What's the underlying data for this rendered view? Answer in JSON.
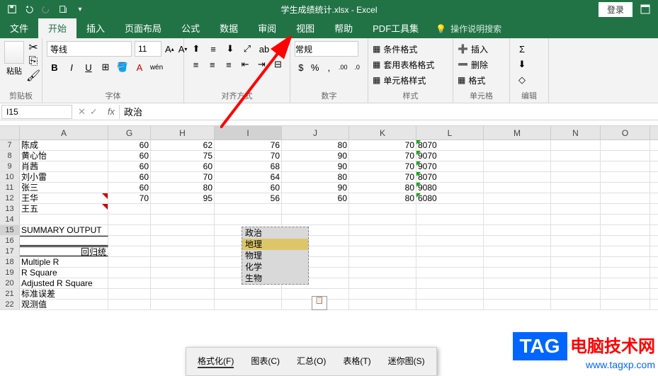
{
  "titlebar": {
    "filename": "学生成绩统计.xlsx",
    "app": "Excel",
    "login": "登录"
  },
  "tabs": {
    "file": "文件",
    "home": "开始",
    "insert": "插入",
    "layout": "页面布局",
    "formula": "公式",
    "data": "数据",
    "review": "审阅",
    "view": "视图",
    "help": "帮助",
    "pdf": "PDF工具集",
    "tellme": "操作说明搜索"
  },
  "ribbon": {
    "clipboard_label": "剪贴板",
    "paste": "粘贴",
    "font_label": "字体",
    "font_name": "等线",
    "font_size": "11",
    "align_label": "对齐方式",
    "number_label": "数字",
    "number_format": "常规",
    "styles_label": "样式",
    "cond_format": "条件格式",
    "table_format": "套用表格格式",
    "cell_style": "单元格样式",
    "cells_label": "单元格",
    "insert_btn": "插入",
    "delete_btn": "删除",
    "format_btn": "格式",
    "edit_label": "编辑"
  },
  "namebox": {
    "ref": "I15",
    "formula": "政治"
  },
  "columns": [
    "A",
    "G",
    "H",
    "I",
    "J",
    "K",
    "L",
    "M",
    "N",
    "O"
  ],
  "rows": [
    {
      "n": "7",
      "A": "陈成",
      "G": "60",
      "H": "62",
      "I": "76",
      "J": "80",
      "K": "70",
      "L": "8070"
    },
    {
      "n": "8",
      "A": "黄心怡",
      "G": "60",
      "H": "75",
      "I": "70",
      "J": "90",
      "K": "70",
      "L": "9070"
    },
    {
      "n": "9",
      "A": "肖茜",
      "G": "60",
      "H": "60",
      "I": "68",
      "J": "90",
      "K": "70",
      "L": "9070"
    },
    {
      "n": "10",
      "A": "刘小雷",
      "G": "60",
      "H": "70",
      "I": "64",
      "J": "80",
      "K": "70",
      "L": "8070"
    },
    {
      "n": "11",
      "A": "张三",
      "G": "60",
      "H": "80",
      "I": "60",
      "J": "90",
      "K": "80",
      "L": "9080"
    },
    {
      "n": "12",
      "A": "王华",
      "G": "70",
      "H": "95",
      "I": "56",
      "J": "60",
      "K": "80",
      "L": "6080"
    },
    {
      "n": "13",
      "A": "王五"
    },
    {
      "n": "14"
    },
    {
      "n": "15",
      "A": "SUMMARY OUTPUT"
    },
    {
      "n": "16"
    },
    {
      "n": "17",
      "A": "回归统"
    },
    {
      "n": "18",
      "A": "Multiple R"
    },
    {
      "n": "19",
      "A": "R Square"
    },
    {
      "n": "20",
      "A": "Adjusted R Square"
    },
    {
      "n": "21",
      "A": "标准误差"
    },
    {
      "n": "22",
      "A": "观测值"
    }
  ],
  "paste_preview": [
    "政治",
    "地理",
    "物理",
    "化学",
    "生物"
  ],
  "ctx_menu": {
    "format": "格式化(F)",
    "chart": "图表(C)",
    "total": "汇总(O)",
    "table": "表格(T)",
    "spark": "迷你图(S)"
  },
  "watermark": {
    "tag": "TAG",
    "line1": "电脑技术网",
    "line2": "www.tagxp.com"
  }
}
